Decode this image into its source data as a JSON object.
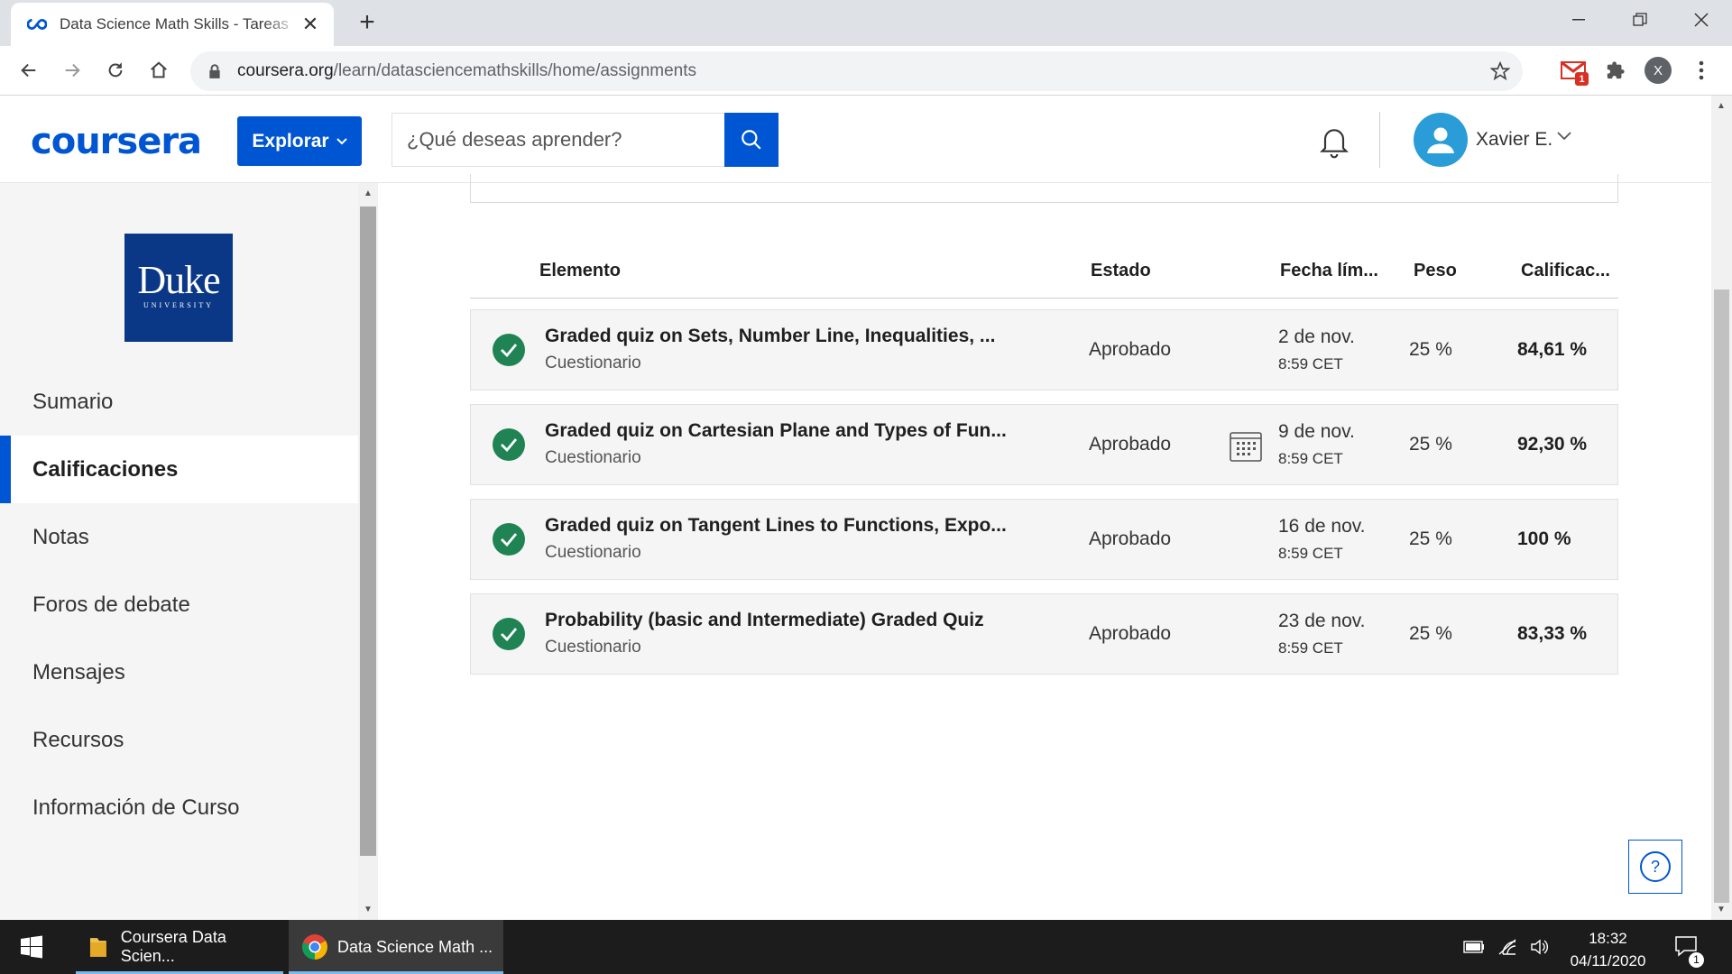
{
  "browser": {
    "tab_title": "Data Science Math Skills - Tareas",
    "url_host": "coursera.org",
    "url_path": "/learn/datasciencemathskills/home/assignments",
    "gmail_badge": "1",
    "profile_initial": "X"
  },
  "header": {
    "logo": "coursera",
    "explore_label": "Explorar",
    "search_placeholder": "¿Qué deseas aprender?",
    "username": "Xavier E."
  },
  "sidebar": {
    "duke_word": "Duke",
    "duke_univ": "UNIVERSITY",
    "items": [
      {
        "label": "Sumario",
        "active": false
      },
      {
        "label": "Calificaciones",
        "active": true
      },
      {
        "label": "Notas",
        "active": false
      },
      {
        "label": "Foros de debate",
        "active": false
      },
      {
        "label": "Mensajes",
        "active": false
      },
      {
        "label": "Recursos",
        "active": false
      },
      {
        "label": "Información de Curso",
        "active": false
      }
    ]
  },
  "table": {
    "headers": {
      "item": "Elemento",
      "status": "Estado",
      "due": "Fecha lím...",
      "weight": "Peso",
      "grade": "Calificac..."
    },
    "rows": [
      {
        "title": "Graded quiz on Sets, Number Line, Inequalities, ...",
        "type": "Cuestionario",
        "status": "Aprobado",
        "date": "2 de nov.",
        "time": "8:59 CET",
        "weight": "25 %",
        "grade": "84,61 %",
        "calendar": false
      },
      {
        "title": "Graded quiz on Cartesian Plane and Types of Fun...",
        "type": "Cuestionario",
        "status": "Aprobado",
        "date": "9 de nov.",
        "time": "8:59 CET",
        "weight": "25 %",
        "grade": "92,30 %",
        "calendar": true
      },
      {
        "title": "Graded quiz on Tangent Lines to Functions, Expo...",
        "type": "Cuestionario",
        "status": "Aprobado",
        "date": "16 de nov.",
        "time": "8:59 CET",
        "weight": "25 %",
        "grade": "100 %",
        "calendar": false
      },
      {
        "title": "Probability (basic and Intermediate) Graded Quiz",
        "type": "Cuestionario",
        "status": "Aprobado",
        "date": "23 de nov.",
        "time": "8:59 CET",
        "weight": "25 %",
        "grade": "83,33 %",
        "calendar": false
      }
    ]
  },
  "help_label": "?",
  "taskbar": {
    "items": [
      {
        "label": "Coursera Data Scien...",
        "icon": "folder-icon"
      },
      {
        "label": "Data Science Math ...",
        "icon": "chrome-icon"
      }
    ],
    "time": "18:32",
    "date": "04/11/2020",
    "notifications": "1"
  },
  "colors": {
    "brand": "#0056d2",
    "success": "#1f8354",
    "duke": "#0b3886"
  }
}
